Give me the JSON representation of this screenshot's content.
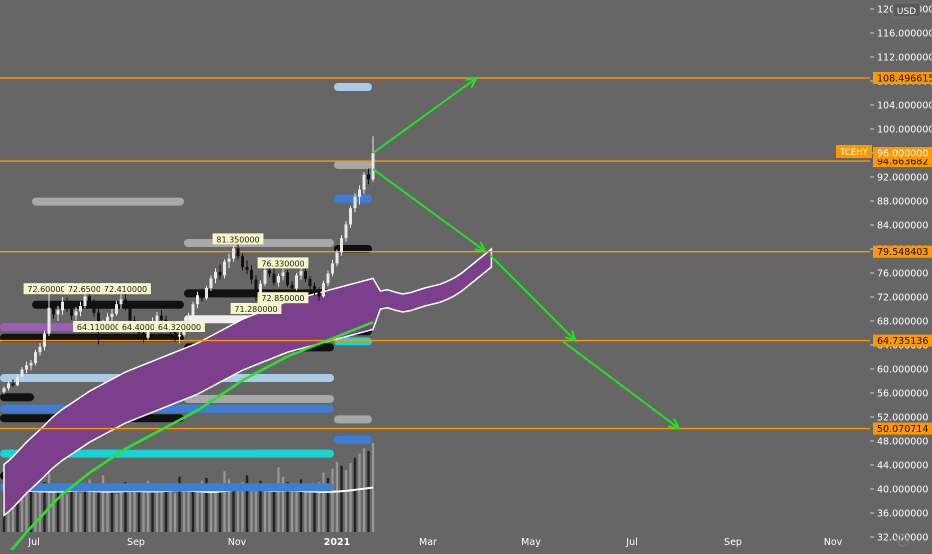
{
  "currency_label": "USD",
  "symbol_tag": "TCEHY",
  "colors": {
    "background": "#666666",
    "hline": "#ff9800",
    "arrow": "#22e022",
    "ma": "#2ee02e",
    "cloud": "#7b3f8c",
    "tag_bg": "#ff9800"
  },
  "chart_data": {
    "type": "candlestick",
    "title": "",
    "xlabel": "",
    "ylabel": "",
    "ylim": [
      31.5,
      121.5
    ],
    "x_ticks": [
      "Jul",
      "Sep",
      "Nov",
      "2021",
      "Mar",
      "May",
      "Jul",
      "Sep",
      "Nov"
    ],
    "y_ticks": [
      "32.000000",
      "36.000000",
      "40.000000",
      "44.000000",
      "48.000000",
      "52.000000",
      "56.000000",
      "60.000000",
      "64.000000",
      "68.000000",
      "72.000000",
      "76.000000",
      "80.000000",
      "84.000000",
      "88.000000",
      "92.000000",
      "96.000000",
      "100.000000",
      "104.000000",
      "108.000000",
      "112.000000",
      "116.000000",
      "120.000000"
    ],
    "y_tick_values": [
      32,
      36,
      40,
      44,
      48,
      52,
      56,
      60,
      64,
      68,
      72,
      76,
      80,
      84,
      88,
      92,
      96,
      100,
      104,
      108,
      112,
      116,
      120
    ],
    "horizontal_levels": [
      {
        "value": 108.496615,
        "label": "108.496615"
      },
      {
        "value": 94.663682,
        "label": "94.663682"
      },
      {
        "value": 79.548403,
        "label": "79.548403"
      },
      {
        "value": 64.735136,
        "label": "64.735136"
      },
      {
        "value": 50.070714,
        "label": "50.070714"
      }
    ],
    "last_price": {
      "value": 96.0,
      "label": "96.000000"
    },
    "price_annotations": [
      {
        "label": "72.600000",
        "date_index": 10,
        "value": 73.3
      },
      {
        "label": "72.650000",
        "date_index": 19,
        "value": 73.3
      },
      {
        "label": "72.410000",
        "date_index": 27,
        "value": 73.3
      },
      {
        "label": "81.350000",
        "date_index": 52,
        "value": 81.6
      },
      {
        "label": "76.330000",
        "date_index": 62,
        "value": 77.6
      },
      {
        "label": "72.850000",
        "date_index": 62,
        "value": 71.8
      },
      {
        "label": "71.280000",
        "date_index": 56,
        "value": 70.0
      },
      {
        "label": "64.110000",
        "date_index": 21,
        "value": 67.0
      },
      {
        "label": "64.400000",
        "date_index": 31,
        "value": 67.0
      },
      {
        "label": "64.320000",
        "date_index": 39,
        "value": 67.0
      }
    ],
    "arrows": [
      {
        "from": {
          "date_index": 82,
          "value": 96.0
        },
        "to": {
          "date_index": 105,
          "value": 108.5
        }
      },
      {
        "from": {
          "date_index": 82,
          "value": 93.3
        },
        "to": {
          "date_index": 107,
          "value": 79.6
        }
      },
      {
        "from": {
          "date_index": 108,
          "value": 79.0
        },
        "to": {
          "date_index": 127,
          "value": 64.7
        }
      },
      {
        "from": {
          "date_index": 124,
          "value": 64.7
        },
        "to": {
          "date_index": 150,
          "value": 50.1
        }
      }
    ],
    "ohlc": [
      [
        56.2,
        57.1,
        55.8,
        56.8
      ],
      [
        56.8,
        58.0,
        56.4,
        57.6
      ],
      [
        57.6,
        58.3,
        57.0,
        57.3
      ],
      [
        57.3,
        59.1,
        57.1,
        58.7
      ],
      [
        58.7,
        60.3,
        58.2,
        59.9
      ],
      [
        59.9,
        61.2,
        59.3,
        60.6
      ],
      [
        60.6,
        61.5,
        59.8,
        61.0
      ],
      [
        61.0,
        63.2,
        60.6,
        62.8
      ],
      [
        62.8,
        64.3,
        62.2,
        63.7
      ],
      [
        63.7,
        66.4,
        63.1,
        65.9
      ],
      [
        65.9,
        72.8,
        65.5,
        70.2
      ],
      [
        70.2,
        71.0,
        68.4,
        69.1
      ],
      [
        69.1,
        70.5,
        68.0,
        69.8
      ],
      [
        69.8,
        72.0,
        69.0,
        71.2
      ],
      [
        71.2,
        71.9,
        69.5,
        70.0
      ],
      [
        70.0,
        70.8,
        68.2,
        68.9
      ],
      [
        68.9,
        70.3,
        68.1,
        69.6
      ],
      [
        69.6,
        71.2,
        68.8,
        70.5
      ],
      [
        70.5,
        72.9,
        70.1,
        72.1
      ],
      [
        72.1,
        72.7,
        70.3,
        70.9
      ],
      [
        70.9,
        71.6,
        68.7,
        69.4
      ],
      [
        69.4,
        70.1,
        64.1,
        66.8
      ],
      [
        66.8,
        68.2,
        66.2,
        67.6
      ],
      [
        67.6,
        69.3,
        67.0,
        68.7
      ],
      [
        68.7,
        70.0,
        68.0,
        69.2
      ],
      [
        69.2,
        71.4,
        68.9,
        70.8
      ],
      [
        70.8,
        72.4,
        70.0,
        71.6
      ],
      [
        71.6,
        72.5,
        69.8,
        70.2
      ],
      [
        70.2,
        70.9,
        67.5,
        68.1
      ],
      [
        68.1,
        68.8,
        66.3,
        67.0
      ],
      [
        67.0,
        67.5,
        65.2,
        66.0
      ],
      [
        66.0,
        66.6,
        64.4,
        65.2
      ],
      [
        65.2,
        67.3,
        64.9,
        66.8
      ],
      [
        66.8,
        68.6,
        66.4,
        68.0
      ],
      [
        68.0,
        69.5,
        67.3,
        68.9
      ],
      [
        68.9,
        69.8,
        67.6,
        68.2
      ],
      [
        68.2,
        68.9,
        66.4,
        67.1
      ],
      [
        67.1,
        67.7,
        65.5,
        66.3
      ],
      [
        66.3,
        66.9,
        64.5,
        65.4
      ],
      [
        65.4,
        66.2,
        64.3,
        65.7
      ],
      [
        65.7,
        68.1,
        65.4,
        67.6
      ],
      [
        67.6,
        69.4,
        67.0,
        68.9
      ],
      [
        68.9,
        71.2,
        68.5,
        70.8
      ],
      [
        70.8,
        72.9,
        70.1,
        72.3
      ],
      [
        72.3,
        73.4,
        71.2,
        71.8
      ],
      [
        71.8,
        73.9,
        71.5,
        73.5
      ],
      [
        73.5,
        75.6,
        73.0,
        75.1
      ],
      [
        75.1,
        76.8,
        74.3,
        76.2
      ],
      [
        76.2,
        77.4,
        74.9,
        75.6
      ],
      [
        75.6,
        78.3,
        75.1,
        77.9
      ],
      [
        77.9,
        79.2,
        76.8,
        78.4
      ],
      [
        78.4,
        80.6,
        77.9,
        80.1
      ],
      [
        80.1,
        81.4,
        78.3,
        78.8
      ],
      [
        78.8,
        79.3,
        76.4,
        77.0
      ],
      [
        77.0,
        78.1,
        75.8,
        76.5
      ],
      [
        76.5,
        77.3,
        74.2,
        74.9
      ],
      [
        74.9,
        75.6,
        71.3,
        72.4
      ],
      [
        72.4,
        74.8,
        72.0,
        74.2
      ],
      [
        74.2,
        77.1,
        73.8,
        76.5
      ],
      [
        76.5,
        77.8,
        75.3,
        75.9
      ],
      [
        75.9,
        76.8,
        73.9,
        74.4
      ],
      [
        74.4,
        75.9,
        73.7,
        75.5
      ],
      [
        75.5,
        76.7,
        74.8,
        76.1
      ],
      [
        76.1,
        76.5,
        73.6,
        74.0
      ],
      [
        74.0,
        74.6,
        72.9,
        73.4
      ],
      [
        73.4,
        76.0,
        73.1,
        75.6
      ],
      [
        75.6,
        77.0,
        74.9,
        76.3
      ],
      [
        76.3,
        76.9,
        74.5,
        75.0
      ],
      [
        75.0,
        75.5,
        73.1,
        73.8
      ],
      [
        73.8,
        74.4,
        72.2,
        72.9
      ],
      [
        72.9,
        73.6,
        71.4,
        72.1
      ],
      [
        72.1,
        74.7,
        71.9,
        74.3
      ],
      [
        74.3,
        76.4,
        73.8,
        75.9
      ],
      [
        75.9,
        78.2,
        75.4,
        77.6
      ],
      [
        77.6,
        79.9,
        77.1,
        79.4
      ],
      [
        79.4,
        82.3,
        78.9,
        81.8
      ],
      [
        81.8,
        84.6,
        81.2,
        84.1
      ],
      [
        84.1,
        87.2,
        83.5,
        86.8
      ],
      [
        86.8,
        89.3,
        86.1,
        88.7
      ],
      [
        88.7,
        90.6,
        87.4,
        89.9
      ],
      [
        89.9,
        92.8,
        89.2,
        92.4
      ],
      [
        92.4,
        93.4,
        90.8,
        91.6
      ],
      [
        91.6,
        98.8,
        91.2,
        96.0
      ]
    ],
    "volume": [
      38,
      32,
      36,
      30,
      34,
      40,
      33,
      29,
      31,
      37,
      44,
      35,
      30,
      33,
      28,
      31,
      36,
      29,
      34,
      39,
      33,
      30,
      42,
      35,
      31,
      28,
      33,
      37,
      30,
      32,
      29,
      35,
      38,
      31,
      34,
      30,
      36,
      33,
      29,
      41,
      34,
      30,
      35,
      32,
      38,
      40,
      33,
      31,
      36,
      45,
      39,
      34,
      30,
      37,
      42,
      36,
      32,
      38,
      33,
      30,
      35,
      48,
      41,
      37,
      34,
      31,
      39,
      36,
      33,
      30,
      37,
      44,
      40,
      47,
      52,
      49,
      46,
      51,
      55,
      58,
      62,
      60,
      66
    ],
    "indicators": {
      "ma": [
        40.6,
        41.2,
        41.9,
        42.7,
        43.5,
        44.3,
        45.0,
        45.7,
        46.4,
        47.1,
        47.9,
        48.6,
        49.2,
        49.8,
        50.3,
        50.8,
        51.3,
        51.8,
        52.3,
        52.8,
        53.2,
        53.6,
        54.0,
        54.4,
        54.8,
        55.2,
        55.6,
        56.0,
        56.3,
        56.6,
        56.9,
        57.2,
        57.5,
        57.8,
        58.1,
        58.4,
        58.7,
        59.0,
        59.3,
        59.6,
        59.9,
        60.2,
        60.5,
        60.8,
        61.2,
        61.6,
        62.0,
        62.4,
        62.8,
        63.2,
        63.6,
        64.0,
        64.4,
        64.8,
        65.1,
        65.4,
        65.7,
        66.0,
        66.3,
        66.6,
        66.9,
        67.2,
        67.5,
        67.8,
        68.0,
        68.2,
        68.4,
        68.6,
        68.8,
        69.0,
        69.2,
        69.4,
        69.6,
        69.8,
        70.0,
        70.2,
        70.4,
        70.6,
        70.8,
        71.0,
        71.2,
        71.4,
        71.6
      ],
      "bb_mid": [
        42.5,
        42.8,
        43.0,
        43.2,
        43.3,
        43.3,
        43.2,
        43.0,
        42.8,
        42.6,
        42.5,
        42.4,
        42.5,
        42.7,
        43.0,
        43.3,
        43.5,
        43.6,
        43.5,
        43.3,
        43.0,
        42.8,
        42.6,
        42.5,
        42.5,
        42.6,
        42.8,
        43.0,
        43.1,
        43.2,
        43.1,
        42.9,
        42.7,
        42.6,
        42.7,
        42.9,
        43.2,
        43.5,
        43.7,
        43.8,
        43.7,
        43.5,
        43.2,
        42.9,
        42.6,
        42.3,
        42.2,
        42.3,
        42.6,
        43.0,
        43.6,
        44.2,
        44.7,
        45.0,
        45.1,
        44.9,
        44.6,
        44.2,
        43.8,
        43.5,
        43.3,
        43.4,
        43.6,
        43.8,
        43.7,
        43.5,
        43.2,
        42.9,
        42.7,
        42.5,
        42.4,
        42.3,
        42.3,
        42.4,
        42.6,
        42.9,
        43.3,
        43.8,
        44.4,
        45.0,
        45.6,
        46.2,
        46.8
      ]
    },
    "cloud_future_values": [
      79.0,
      79.2,
      78.8,
      78.5,
      78.7,
      79.1,
      79.5,
      79.8,
      80.1,
      80.6,
      81.2,
      82.0,
      83.0,
      84.0,
      85.0,
      86.0
    ]
  }
}
